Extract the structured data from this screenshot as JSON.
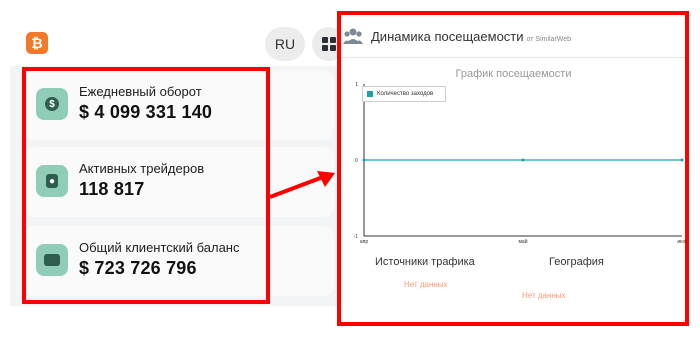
{
  "header": {
    "lang_label": "RU"
  },
  "stats": [
    {
      "label": "Ежедневный оборот",
      "value": "$ 4 099 331 140",
      "icon": "dollar-icon"
    },
    {
      "label": "Активных трейдеров",
      "value": "118 817",
      "icon": "user-badge-icon"
    },
    {
      "label": "Общий клиентский баланс",
      "value": "$ 723 726 796",
      "icon": "wallet-icon"
    }
  ],
  "traffic": {
    "title": "Динамика посещаемости",
    "source": "от SimilarWeb",
    "chart_title": "График посещаемости",
    "traffic_sources_title": "Источники трафика",
    "geography_title": "География",
    "no_data_sources": "Нет данных",
    "no_data_geo": "Нет данных"
  },
  "chart_data": {
    "type": "line",
    "title": "График посещаемости",
    "x": [
      "апр",
      "май",
      "июн"
    ],
    "series": [
      {
        "name": "Количество заходов",
        "values": [
          0,
          0,
          0
        ]
      }
    ],
    "ylim": [
      -1,
      1
    ],
    "y_ticks": [
      "1",
      "0",
      "-1"
    ],
    "grid": false,
    "legend": "top-left",
    "color": "#1aa3a3"
  },
  "colors": {
    "accent": "#f07a2a",
    "icon_bg": "#8fcdb6",
    "highlight": "#ff0000",
    "no_data": "#ff9a7a",
    "series": "#1aa3a3"
  }
}
